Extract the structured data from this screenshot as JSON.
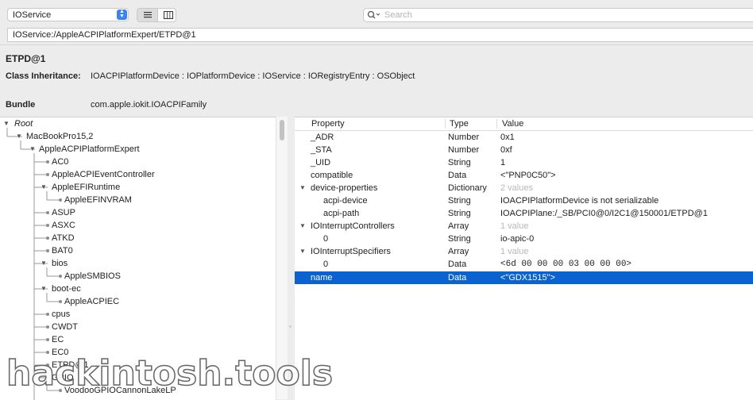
{
  "toolbar": {
    "plane_select": "IOService",
    "search_placeholder": "Search"
  },
  "path": "IOService:/AppleACPIPlatformExpert/ETPD@1",
  "info": {
    "title": "ETPD@1",
    "inheritance_label": "Class Inheritance:",
    "inheritance_value": "IOACPIPlatformDevice : IOPlatformDevice : IOService : IORegistryEntry : OSObject",
    "bundle_label": "Bundle",
    "bundle_value": "com.apple.iokit.IOACPIFamily"
  },
  "tree": [
    {
      "label": "Root",
      "italic": true
    },
    {
      "label": "MacBookPro15,2"
    },
    {
      "label": "AppleACPIPlatformExpert"
    },
    {
      "label": "AC0"
    },
    {
      "label": "AppleACPIEventController"
    },
    {
      "label": "AppleEFIRuntime"
    },
    {
      "label": "AppleEFINVRAM"
    },
    {
      "label": "ASUP"
    },
    {
      "label": "ASXC"
    },
    {
      "label": "ATKD"
    },
    {
      "label": "BAT0"
    },
    {
      "label": "bios"
    },
    {
      "label": "AppleSMBIOS"
    },
    {
      "label": "boot-ec"
    },
    {
      "label": "AppleACPIEC"
    },
    {
      "label": "cpus"
    },
    {
      "label": "CWDT"
    },
    {
      "label": "EC"
    },
    {
      "label": "EC0"
    },
    {
      "label": "ETPD@1"
    },
    {
      "label": "GPIO"
    },
    {
      "label": "VoodooGPIOCannonLakeLP"
    }
  ],
  "props": {
    "headers": {
      "property": "Property",
      "type": "Type",
      "value": "Value"
    },
    "rows": [
      {
        "property": "_ADR",
        "type": "Number",
        "value": "0x1"
      },
      {
        "property": "_STA",
        "type": "Number",
        "value": "0xf"
      },
      {
        "property": "_UID",
        "type": "String",
        "value": "1"
      },
      {
        "property": "compatible",
        "type": "Data",
        "value": "<\"PNP0C50\">"
      },
      {
        "property": "device-properties",
        "type": "Dictionary",
        "value": "2 values"
      },
      {
        "property": "acpi-device",
        "type": "String",
        "value": "IOACPIPlatformDevice is not serializable"
      },
      {
        "property": "acpi-path",
        "type": "String",
        "value": "IOACPIPlane:/_SB/PCI0@0/I2C1@150001/ETPD@1"
      },
      {
        "property": "IOInterruptControllers",
        "type": "Array",
        "value": "1 value"
      },
      {
        "property": "0",
        "type": "String",
        "value": "io-apic-0"
      },
      {
        "property": "IOInterruptSpecifiers",
        "type": "Array",
        "value": "1 value"
      },
      {
        "property": "0",
        "type": "Data",
        "value": "<6d 00 00 00 03 00 00 00>"
      },
      {
        "property": "name",
        "type": "Data",
        "value": "<\"GDX1515\">"
      }
    ]
  },
  "watermark": "hackintosh.tools",
  "colors": {
    "selection": "#0a63d0",
    "accent": "#3b82f6"
  }
}
